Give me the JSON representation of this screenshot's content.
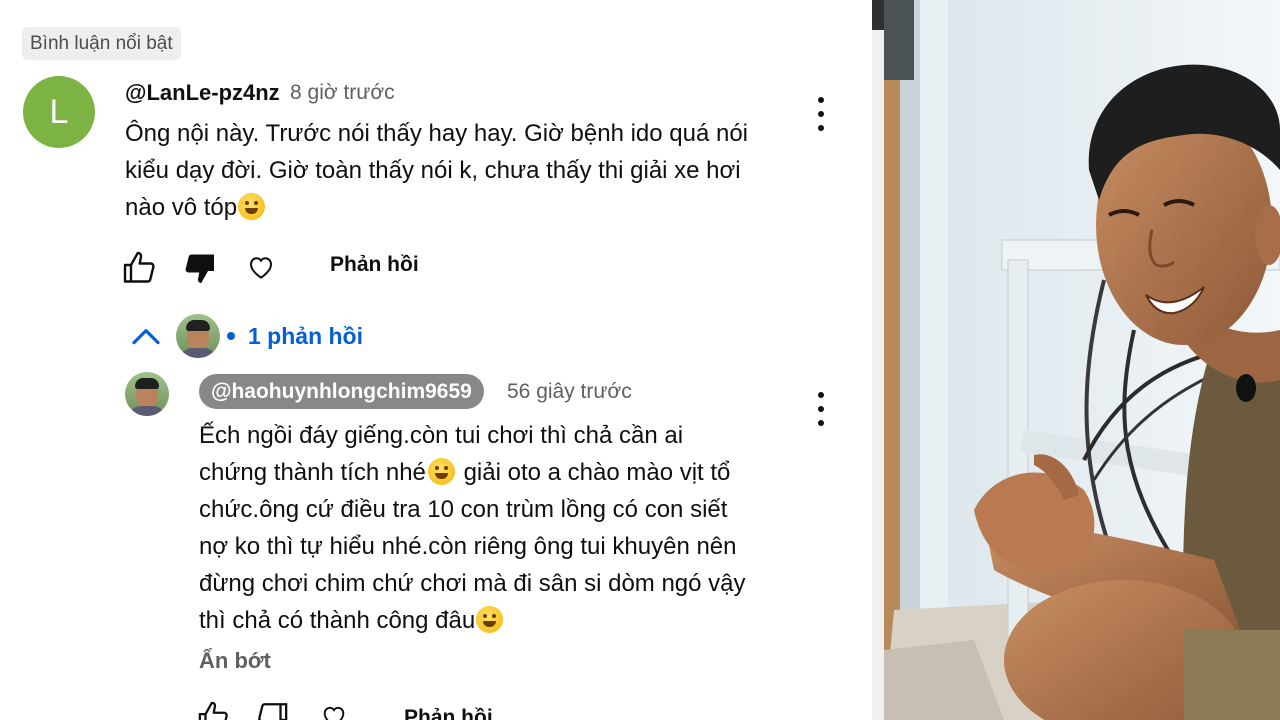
{
  "section_label": "Bình luận nổi bật",
  "comment": {
    "avatar_letter": "L",
    "author": "@LanLe-pz4nz",
    "time": "8 giờ trước",
    "lines": [
      "Ông nội này. Trước nói thấy hay hay. Giờ bệnh ido quá nói",
      "kiểu dạy đời. Giờ toàn thấy nói k, chưa thấy thi giải xe hơi",
      "nào vô tóp"
    ],
    "emoji": "laughing-emoji",
    "reply_label": "Phản hồi"
  },
  "thread": {
    "count_label": "1 phản hồi"
  },
  "reply": {
    "author": "@haohuynhlongchim9659",
    "time": "56 giây trước",
    "lines": [
      "Ếch ngồi đáy giếng.còn tui chơi thì chả cần ai",
      "chứng thành tích nhé",
      " giải oto a chào mào vịt tổ",
      "chức.ông cứ điều tra 10 con trùm lồng có con siết",
      "nợ ko thì tự hiểu nhé.còn riêng ông tui khuyên nên",
      "đừng chơi chim chứ chơi mà đi sân si dòm ngó vậy",
      "thì chả có thành công đâu"
    ],
    "emojis": [
      "grinning-emoji",
      "winking-emoji"
    ],
    "show_less": "Ẩn bớt",
    "reply_label": "Phản hồi"
  },
  "colors": {
    "avatar_green": "#7cb342",
    "link_blue": "#065fd4",
    "handle_chip": "#888888"
  }
}
